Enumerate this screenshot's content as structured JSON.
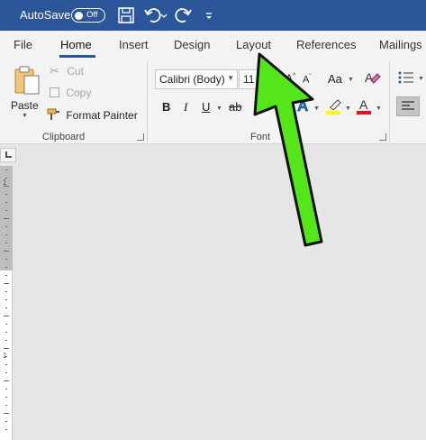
{
  "titlebar": {
    "autosave_label": "AutoSave",
    "autosave_state": "Off",
    "icons": [
      "save-icon",
      "undo-icon",
      "undo-dropdown-icon",
      "redo-icon",
      "customize-quick-access-icon"
    ]
  },
  "tabs": [
    {
      "label": "File"
    },
    {
      "label": "Home"
    },
    {
      "label": "Insert"
    },
    {
      "label": "Design"
    },
    {
      "label": "Layout"
    },
    {
      "label": "References"
    },
    {
      "label": "Mailings"
    }
  ],
  "active_tab": "Home",
  "clipboard": {
    "paste_label": "Paste",
    "cut_label": "Cut",
    "copy_label": "Copy",
    "format_painter_label": "Format Painter",
    "group_label": "Clipboard"
  },
  "font": {
    "font_name": "Calibri (Body)",
    "font_size": "11",
    "change_case_label": "Aa",
    "bold_label": "B",
    "italic_label": "I",
    "underline_label": "U",
    "strikethrough_label": "ab",
    "text_effects_label": "A",
    "font_color_label": "A",
    "group_label": "Font"
  },
  "ruler": {
    "vertical_numbers": [
      "1",
      "1"
    ]
  },
  "colors": {
    "titlebar": "#2b579a",
    "ribbon_bg": "#f3f3f3",
    "highlight_yellow": "#ffff00",
    "font_color_red": "#e81123",
    "arrow_green": "#55e61a"
  }
}
